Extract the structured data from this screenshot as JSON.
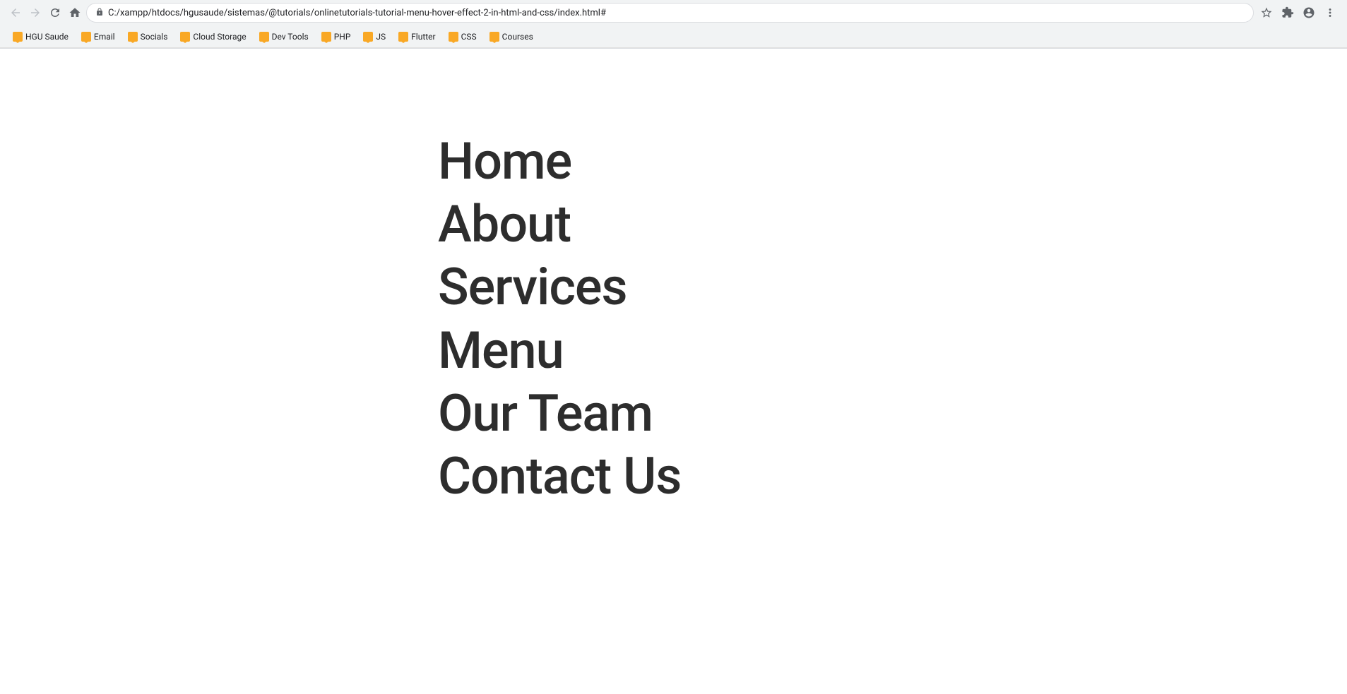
{
  "browser": {
    "url": "C:/xampp/htdocs/hgusaude/sistemas/@tutorials/onlinetutorials-tutorial-menu-hover-effect-2-in-html-and-css/index.html#",
    "nav_buttons": {
      "back": "‹",
      "forward": "›",
      "reload": "↻",
      "home": "⌂"
    },
    "toolbar_buttons": {
      "bookmark": "☆",
      "extensions": "🧩",
      "profile": "👤",
      "menu": "⋮"
    }
  },
  "bookmarks": [
    {
      "id": "hgu-saude",
      "label": "HGU Saude"
    },
    {
      "id": "email",
      "label": "Email"
    },
    {
      "id": "socials",
      "label": "Socials"
    },
    {
      "id": "cloud-storage",
      "label": "Cloud Storage"
    },
    {
      "id": "dev-tools",
      "label": "Dev Tools"
    },
    {
      "id": "php",
      "label": "PHP"
    },
    {
      "id": "js",
      "label": "JS"
    },
    {
      "id": "flutter",
      "label": "Flutter"
    },
    {
      "id": "css",
      "label": "CSS"
    },
    {
      "id": "courses",
      "label": "Courses"
    }
  ],
  "menu": {
    "items": [
      {
        "id": "home",
        "label": "Home"
      },
      {
        "id": "about",
        "label": "About"
      },
      {
        "id": "services",
        "label": "Services"
      },
      {
        "id": "menu",
        "label": "Menu"
      },
      {
        "id": "our-team",
        "label": "Our Team"
      },
      {
        "id": "contact-us",
        "label": "Contact Us"
      }
    ]
  }
}
